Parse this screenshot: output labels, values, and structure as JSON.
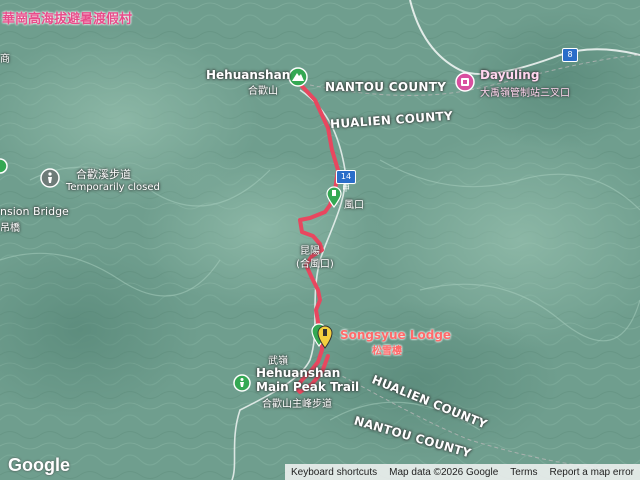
{
  "map": {
    "top_banner": "華崗高海拔避暑渡假村",
    "places": {
      "hehuanshan": {
        "name": "Hehuanshan",
        "sub": "合歡山"
      },
      "dayuling": {
        "name": "Dayuling",
        "sub": "大禹嶺管制站三叉口"
      },
      "trail": {
        "name_line1": "Hehuanshan",
        "name_line2": "Main Peak Trail",
        "sub": "合歡山主峰步道"
      },
      "creek": {
        "name": "合歡溪步道",
        "status": "Temporarily closed"
      },
      "lodge": {
        "name": "Songsyue Lodge",
        "sub": "松雪樓"
      },
      "bridge": {
        "name": "nsion Bridge",
        "sub": "吊橋"
      },
      "wuling": "武嶺",
      "pass": {
        "line1": "昆陽",
        "line2": "(合風口)"
      },
      "fengkou": "風口",
      "left_edge": "商"
    },
    "counties": {
      "nantou_top": "NANTOU COUNTY",
      "hualien_top": "HUALIEN COUNTY",
      "hualien_bottom": "HUALIEN COUNTY",
      "nantou_bottom": "NANTOU COUNTY"
    },
    "road_shields": [
      "8",
      "14甲"
    ],
    "colors": {
      "route": "#e8475f",
      "terrain": "#6f9e8e",
      "marker_green": "#34a853",
      "marker_yellow": "#f4d03f",
      "lodge_text": "#ff5c7a"
    }
  },
  "footer": {
    "logo": "Google",
    "keyboard": "Keyboard shortcuts",
    "mapdata": "Map data ©2026 Google",
    "terms": "Terms",
    "report": "Report a map error"
  }
}
